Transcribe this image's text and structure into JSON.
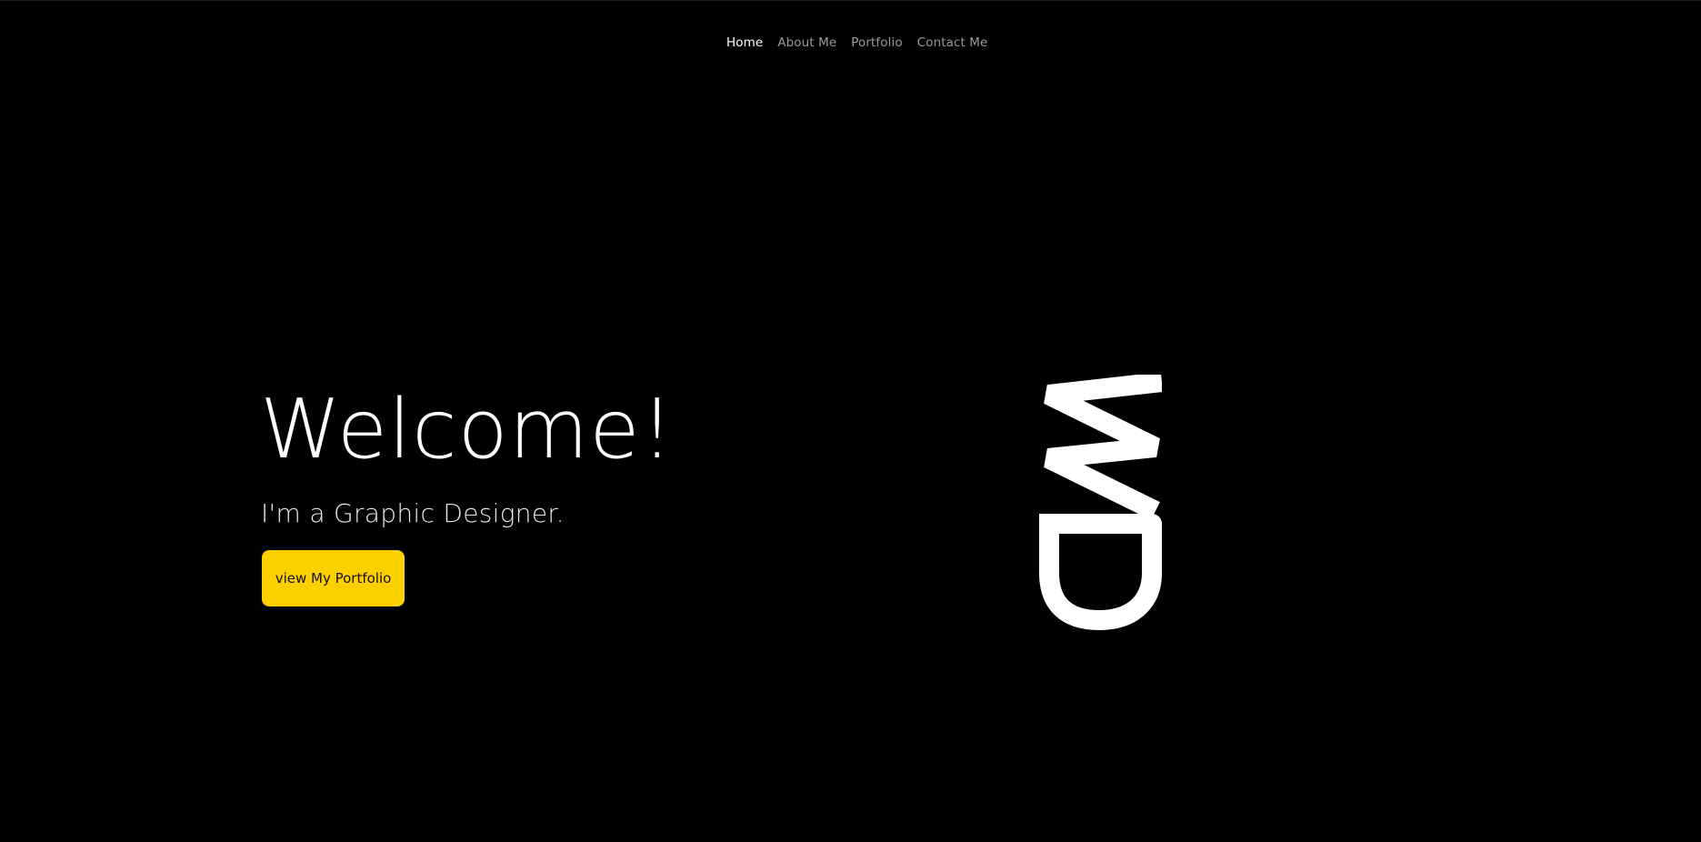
{
  "nav": {
    "items": [
      {
        "label": "Home",
        "active": true
      },
      {
        "label": "About Me",
        "active": false
      },
      {
        "label": "Portfolio",
        "active": false
      },
      {
        "label": "Contact Me",
        "active": false
      }
    ]
  },
  "hero": {
    "title": "Welcome!",
    "subtitle": "I'm a Graphic Designer.",
    "cta_label": "view My Portfolio"
  },
  "logo": {
    "icon": "wd-monogram-logo",
    "text": "WD"
  },
  "colors": {
    "background": "#000000",
    "accent": "#ffd000",
    "text": "#ffffff",
    "nav_inactive": "#9a9a9a"
  }
}
